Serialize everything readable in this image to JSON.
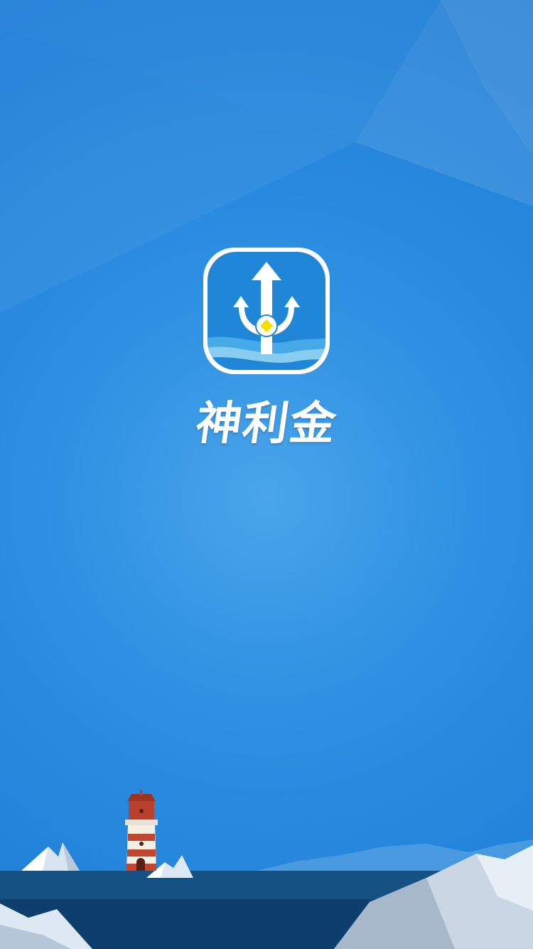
{
  "app": {
    "name": "神利金"
  },
  "icons": {
    "logo": "trident-arrow-logo-icon",
    "lighthouse": "lighthouse-illustration"
  },
  "colors": {
    "background_primary": "#2d90e2",
    "background_center": "#4aa5ea",
    "logo_blue": "#1f86d8",
    "logo_accent_yellow": "#f1e000",
    "sea_dark": "#0c3f6e",
    "lighthouse_red": "#b8402c"
  }
}
